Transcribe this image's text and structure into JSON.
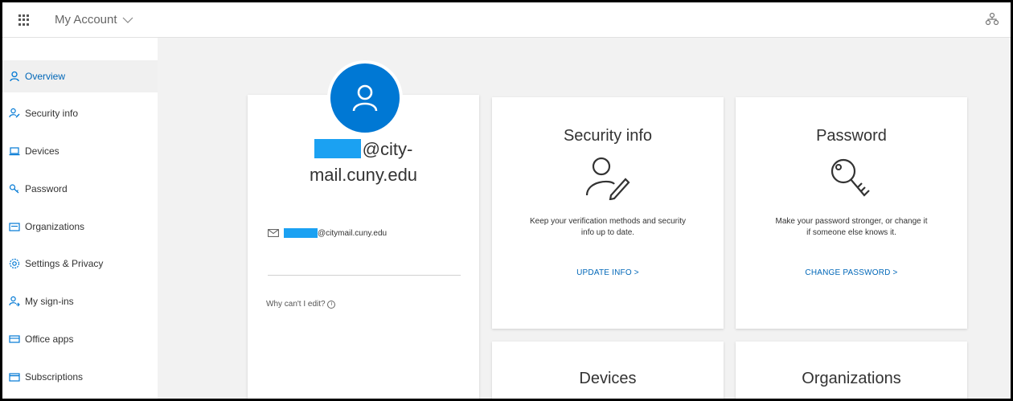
{
  "header": {
    "app_title": "My Account",
    "waffle_icon": "waffle-icon",
    "org_icon": "organization-icon"
  },
  "sidebar": {
    "items": [
      {
        "label": "Overview",
        "icon": "person-icon",
        "active": true
      },
      {
        "label": "Security info",
        "icon": "security-info-icon"
      },
      {
        "label": "Devices",
        "icon": "laptop-icon"
      },
      {
        "label": "Password",
        "icon": "key-icon"
      },
      {
        "label": "Organizations",
        "icon": "briefcase-icon"
      },
      {
        "label": "Settings & Privacy",
        "icon": "gear-icon"
      },
      {
        "label": "My sign-ins",
        "icon": "signin-icon"
      },
      {
        "label": "Office apps",
        "icon": "office-icon"
      },
      {
        "label": "Subscriptions",
        "icon": "subscriptions-icon"
      }
    ]
  },
  "profile": {
    "name_line1_suffix": "@city-",
    "name_line2": "mail.cuny.edu",
    "email_suffix": "@citymail.cuny.edu",
    "why_edit": "Why can't I edit?"
  },
  "tiles": {
    "security": {
      "title": "Security info",
      "desc_line1": "Keep your verification methods and security",
      "desc_line2": "info up to date.",
      "link": "UPDATE INFO >"
    },
    "password": {
      "title": "Password",
      "desc_line1": "Make your password stronger, or change it",
      "desc_line2": "if someone else knows it.",
      "link": "CHANGE PASSWORD >"
    },
    "devices": {
      "title": "Devices"
    },
    "organizations": {
      "title": "Organizations"
    }
  },
  "colors": {
    "accent": "#0078d4",
    "link": "#0067b8",
    "redaction": "#1ba1f2"
  }
}
